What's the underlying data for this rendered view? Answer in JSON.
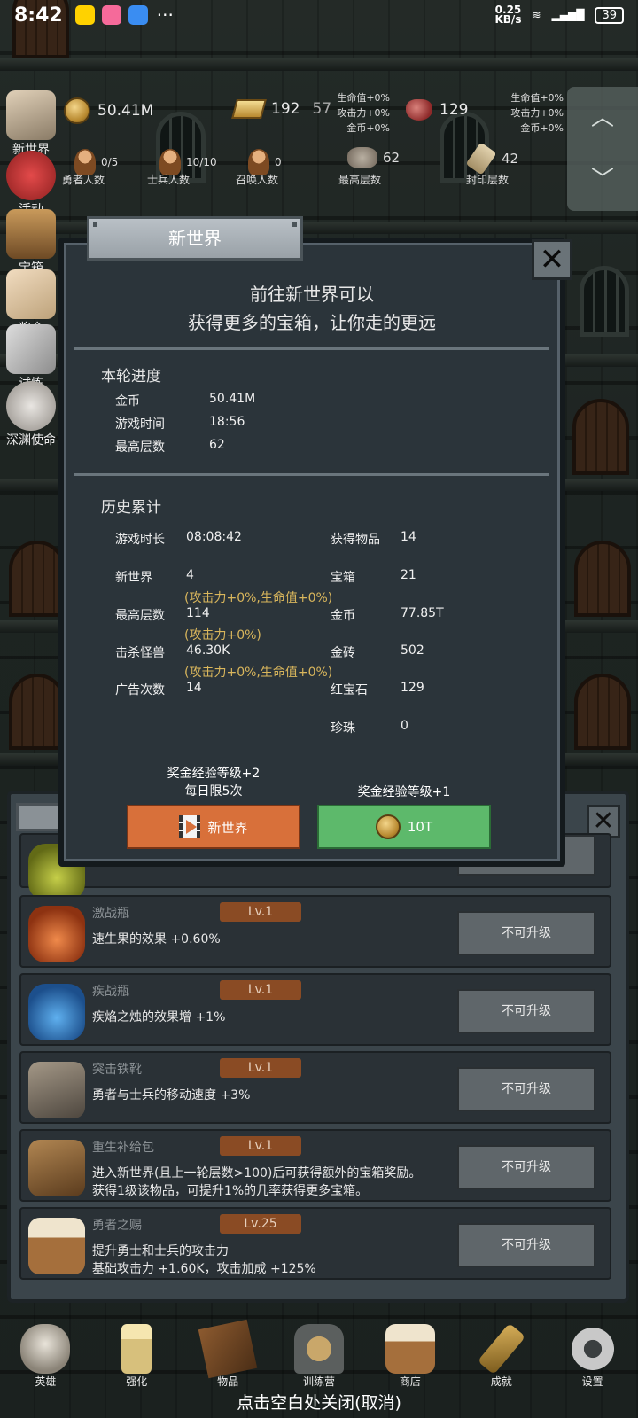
{
  "status": {
    "time": "8:42",
    "speed_top": "0.25",
    "speed_unit": "KB/s",
    "battery": "39"
  },
  "hud": {
    "gold": "50.41M",
    "gold_bar": "192",
    "gold_bar_sub": "57",
    "ruby": "129",
    "buffs_left": [
      "生命值+0%",
      "攻击力+0%",
      "金币+0%"
    ],
    "buffs_right": [
      "生命值+0%",
      "攻击力+0%",
      "金币+0%"
    ],
    "heroes": {
      "value": "0/5",
      "label": "勇者人数"
    },
    "soldiers": {
      "value": "10/10",
      "label": "士兵人数"
    },
    "summons": {
      "value": "0",
      "label": "召唤人数"
    },
    "max_floor": {
      "value": "62",
      "label": "最高层数"
    },
    "sealed_floor": {
      "value": "42",
      "label": "封印层数"
    }
  },
  "side_menu": [
    {
      "label": "新世界"
    },
    {
      "label": "活动"
    },
    {
      "label": "宝箱"
    },
    {
      "label": "奖金"
    },
    {
      "label": "试炼"
    },
    {
      "label": "深渊使命"
    }
  ],
  "dialog": {
    "title": "新世界",
    "headline_1": "前往新世界可以",
    "headline_2": "获得更多的宝箱，让你走的更远",
    "round": {
      "title": "本轮进度",
      "rows": [
        {
          "label": "金币",
          "value": "50.41M"
        },
        {
          "label": "游戏时间",
          "value": "18:56"
        },
        {
          "label": "最高层数",
          "value": "62"
        }
      ]
    },
    "history": {
      "title": "历史累计",
      "left": [
        {
          "label": "游戏时长",
          "value": "08:08:42"
        },
        {
          "label": "新世界",
          "value": "4",
          "note": "(攻击力+0%,生命值+0%)"
        },
        {
          "label": "最高层数",
          "value": "114",
          "note": "(攻击力+0%)"
        },
        {
          "label": "击杀怪兽",
          "value": "46.30K",
          "note": "(攻击力+0%,生命值+0%)"
        },
        {
          "label": "广告次数",
          "value": "14"
        }
      ],
      "right": [
        {
          "label": "获得物品",
          "value": "14"
        },
        {
          "label": "宝箱",
          "value": "21"
        },
        {
          "label": "金币",
          "value": "77.85T"
        },
        {
          "label": "金砖",
          "value": "502"
        },
        {
          "label": "红宝石",
          "value": "129"
        },
        {
          "label": "珍珠",
          "value": "0"
        }
      ]
    },
    "ad_option": {
      "caption_1": "奖金经验等级+2",
      "caption_2": "每日限5次",
      "button": "新世界"
    },
    "gold_option": {
      "caption": "奖金经验等级+1",
      "button": "10T"
    }
  },
  "upgrades": [
    {
      "name": "激战瓶",
      "level": "Lv.1",
      "desc": [
        "速生果的效果 +0.60%"
      ],
      "button": "不可升级"
    },
    {
      "name": "疾战瓶",
      "level": "Lv.1",
      "desc": [
        "疾焰之烛的效果增 +1%"
      ],
      "button": "不可升级"
    },
    {
      "name": "突击铁靴",
      "level": "Lv.1",
      "desc": [
        "勇者与士兵的移动速度 +3%"
      ],
      "button": "不可升级"
    },
    {
      "name": "重生补给包",
      "level": "Lv.1",
      "desc": [
        "进入新世界(且上一轮层数>100)后可获得额外的宝箱奖励。",
        "获得1级该物品，可提升1%的几率获得更多宝箱。"
      ],
      "button": "不可升级"
    },
    {
      "name": "勇者之赐",
      "level": "Lv.25",
      "desc": [
        "提升勇士和士兵的攻击力",
        "基础攻击力 +1.60K，攻击加成 +125%"
      ],
      "button": "不可升级"
    }
  ],
  "bottom_nav": [
    {
      "label": "英雄"
    },
    {
      "label": "强化"
    },
    {
      "label": "物品"
    },
    {
      "label": "训练营"
    },
    {
      "label": "商店"
    },
    {
      "label": "成就"
    },
    {
      "label": "设置"
    }
  ],
  "close_hint": "点击空白处关闭(取消)",
  "colors": {
    "orange_button": "#d8703a",
    "green_button": "#5db96b",
    "note_gold": "#d9b65c",
    "level_badge": "#8a4b24"
  }
}
